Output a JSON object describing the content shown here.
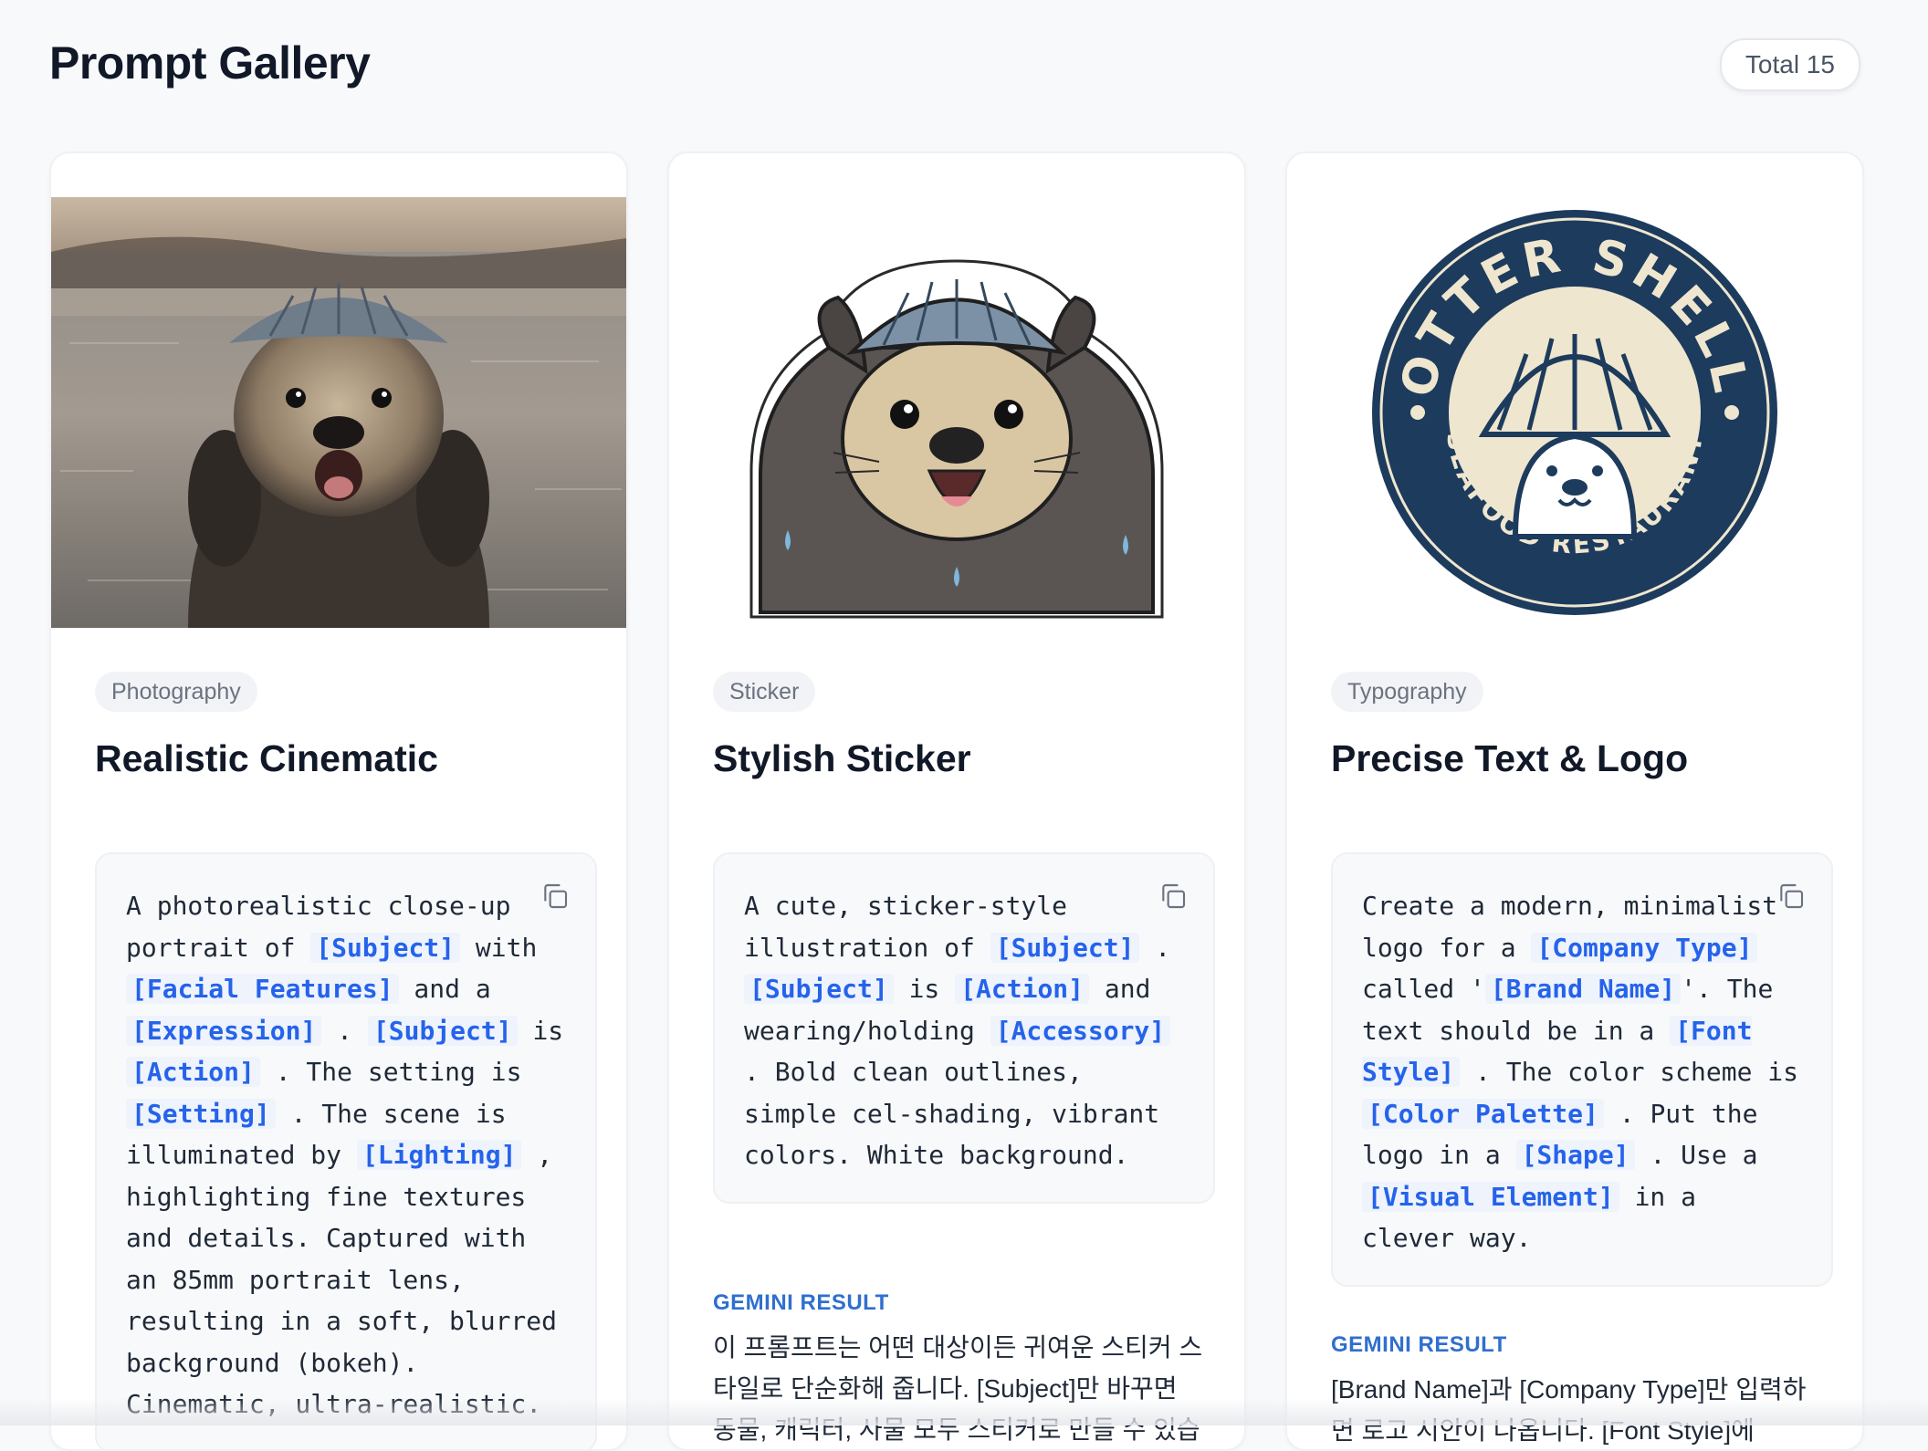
{
  "header": {
    "title": "Prompt Gallery",
    "total_label": "Total 15"
  },
  "cards": [
    {
      "category": "Photography",
      "title": "Realistic Cinematic",
      "prompt": [
        {
          "t": "A photorealistic close-up portrait of "
        },
        {
          "p": "[Subject]"
        },
        {
          "t": " with "
        },
        {
          "p": "[Facial Features]"
        },
        {
          "t": " and a "
        },
        {
          "p": "[Expression]"
        },
        {
          "t": " . "
        },
        {
          "p": "[Subject]"
        },
        {
          "t": " is "
        },
        {
          "p": "[Action]"
        },
        {
          "t": " . The setting is "
        },
        {
          "p": "[Setting]"
        },
        {
          "t": " . The scene is illuminated by "
        },
        {
          "p": "[Lighting]"
        },
        {
          "t": " , highlighting fine textures and details. Captured with an 85mm portrait lens, resulting in a soft, blurred background (bokeh). Cinematic, ultra-realistic."
        }
      ]
    },
    {
      "category": "Sticker",
      "title": "Stylish Sticker",
      "prompt": [
        {
          "t": "A cute, sticker-style illustration of "
        },
        {
          "p": "[Subject]"
        },
        {
          "t": " . "
        },
        {
          "p": "[Subject]"
        },
        {
          "t": " is "
        },
        {
          "p": "[Action]"
        },
        {
          "t": " and wearing/holding "
        },
        {
          "p": "[Accessory]"
        },
        {
          "t": " . Bold clean outlines, simple cel-shading, vibrant colors. White background."
        }
      ],
      "result_label": "GEMINI RESULT",
      "result_text": "이 프롬프트는 어떤 대상이든 귀여운 스티커 스타일로 단순화해 줍니다. [Subject]만 바꾸면 동물, 캐릭터, 사물 모두 스티커로 만들 수 있습니"
    },
    {
      "category": "Typography",
      "title": "Precise Text & Logo",
      "prompt": [
        {
          "t": "Create a modern, minimalist logo for a "
        },
        {
          "p": "[Company Type]"
        },
        {
          "t": " called '"
        },
        {
          "p": "[Brand Name]"
        },
        {
          "t": "'. The text should be in a "
        },
        {
          "p": "[Font Style]"
        },
        {
          "t": " . The color scheme is "
        },
        {
          "p": "[Color Palette]"
        },
        {
          "t": " . Put the logo in a "
        },
        {
          "p": "[Shape]"
        },
        {
          "t": " . Use a "
        },
        {
          "p": "[Visual Element]"
        },
        {
          "t": " in a clever way."
        }
      ],
      "result_label": "GEMINI RESULT",
      "result_text": "[Brand Name]과 [Company Type]만 입력하면 로고 시안이 나옵니다. [Font Style]에"
    }
  ],
  "logo": {
    "top_text": "OTTER SHELL",
    "bottom_text": "SEAFOOD RESTAURANT",
    "navy": "#1d3b5c",
    "cream": "#efe6cf"
  },
  "colors": {
    "placeholder": "#2563eb",
    "result_label": "#2f6fcf"
  }
}
